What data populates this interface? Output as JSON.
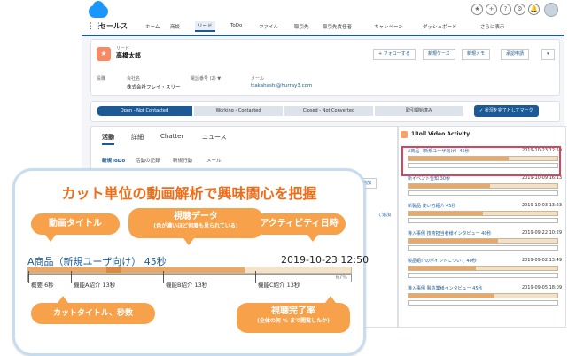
{
  "app": {
    "name": "セールス",
    "nav": [
      "ホーム",
      "商談",
      "リード",
      "ToDo",
      "ファイル",
      "取引先",
      "取引先責任者",
      "キャンペーン",
      "ダッシュボード",
      "さらに表示"
    ]
  },
  "record": {
    "type_label": "リード",
    "name": "高橋太郎",
    "actions": [
      "+ フォローする",
      "新規ケース",
      "新規メモ",
      "承認申請"
    ],
    "fields": {
      "title_label": "役職",
      "company_label": "会社名",
      "company_value": "株式会社フレイ・スリー",
      "phone_label": "電話番号 (2) ▼",
      "email_label": "メール",
      "email_value": "ttakahashi@hurray3.com"
    }
  },
  "path": {
    "steps": [
      "Open - Not Contacted",
      "Working - Contacted",
      "Closed - Not Converted",
      "取引開始済み"
    ],
    "mark_button": "状況を完了としてマーク"
  },
  "left_panel": {
    "tabs": [
      "活動",
      "詳細",
      "Chatter",
      "ニュース"
    ],
    "subtabs": [
      "新規ToDo",
      "活動の記録",
      "新規行動",
      "メール"
    ],
    "button_label": "追加",
    "side_label": "て追加"
  },
  "video_panel": {
    "title": "1Roll Video Activity",
    "rows": [
      {
        "title": "A商品（新規ユーザ向け）45秒",
        "date": "2019-10-23 12:50",
        "fill": 0.67
      },
      {
        "title": "新イベント告知 30秒",
        "date": "2019-10-09 16:13",
        "fill": 0.55
      },
      {
        "title": "新製品 使い方紹介 45秒",
        "date": "2019-10-03 13:23",
        "fill": 0.5
      },
      {
        "title": "導入事例 技術担当者様インタビュー 40秒",
        "date": "2019-09-22 10:29",
        "fill": 0.6
      },
      {
        "title": "製品紹介のポイントについて 40秒",
        "date": "2019-09-02 13:49",
        "fill": 0.45
      },
      {
        "title": "導入事例 製造業様インタビュー 45秒",
        "date": "2019-09-05 18:09",
        "fill": 0.58
      }
    ]
  },
  "callout": {
    "title": "カット単位の動画解析で興味関心を把握",
    "label_video_title": "動画タイトル",
    "label_view_data": "視聴データ",
    "label_view_data_sub": "(色が濃いほど何度も見られている)",
    "label_activity_date": "アクティビティ日時",
    "label_cut_title": "カットタイトル、秒数",
    "label_completion": "視聴完了率",
    "label_completion_sub": "(全体の何 % まで閲覧したか)",
    "example_title": "A商品（新規ユーザ向け） 45秒",
    "example_date": "2019-10-23 12:50",
    "completion_pct": "67%",
    "completion_value": 0.67,
    "segments": [
      "概要 6秒",
      "機能A紹介 13秒",
      "機能B紹介 13秒",
      "機能C紹介 13秒"
    ]
  }
}
